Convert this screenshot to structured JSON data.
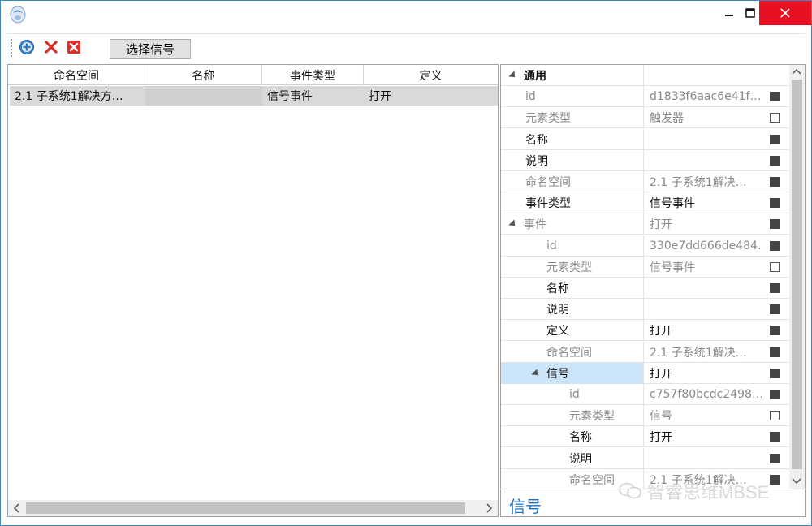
{
  "colors": {
    "accent": "#3a87c8",
    "close": "#e81123",
    "selected_row": "#d9d9d9",
    "selected_prop": "#cce4f7",
    "desc_title": "#1b73c8"
  },
  "toolbar": {
    "select_signal_label": "选择信号"
  },
  "grid": {
    "columns": [
      "命名空间",
      "名称",
      "事件类型",
      "定义"
    ],
    "rows": [
      {
        "namespace": "2.1 子系统1解决方…",
        "name": "",
        "event_type": "信号事件",
        "definition": "打开"
      }
    ]
  },
  "properties": [
    {
      "name": "通用",
      "value": "",
      "category": true
    },
    {
      "name": "id",
      "value": "d1833f6aac6e41f…",
      "muted": true,
      "box": "filled"
    },
    {
      "name": "元素类型",
      "value": "触发器",
      "muted": true,
      "box": "empty"
    },
    {
      "name": "名称",
      "value": "",
      "box": "filled"
    },
    {
      "name": "说明",
      "value": "",
      "box": "filled"
    },
    {
      "name": "命名空间",
      "value": "2.1 子系统1解决…",
      "muted": true,
      "box": "filled"
    },
    {
      "name": "事件类型",
      "value": "信号事件",
      "box": "filled"
    },
    {
      "name": "事件",
      "value": "打开",
      "muted": true,
      "expander": true,
      "box": "filled"
    },
    {
      "name": "id",
      "value": "330e7dd666de484…",
      "muted": true,
      "box": "filled"
    },
    {
      "name": "元素类型",
      "value": "信号事件",
      "muted": true,
      "box": "empty"
    },
    {
      "name": "名称",
      "value": "",
      "box": "filled"
    },
    {
      "name": "说明",
      "value": "",
      "box": "filled"
    },
    {
      "name": "定义",
      "value": "打开",
      "box": "filled"
    },
    {
      "name": "命名空间",
      "value": "2.1 子系统1解决…",
      "muted": true,
      "box": "filled"
    },
    {
      "name": "信号",
      "value": "打开",
      "expander": true,
      "selected": true,
      "box": "filled"
    },
    {
      "name": "id",
      "value": "c757f80bcdc2498…",
      "muted": true,
      "box": "filled"
    },
    {
      "name": "元素类型",
      "value": "信号",
      "muted": true,
      "box": "empty"
    },
    {
      "name": "名称",
      "value": "打开",
      "box": "filled"
    },
    {
      "name": "说明",
      "value": "",
      "box": "filled"
    },
    {
      "name": "命名空间",
      "value": "2.1 子系统1解决…",
      "muted": true,
      "box": "filled"
    }
  ],
  "description": {
    "title": "信号"
  },
  "watermark": "智睿思维MBSE"
}
